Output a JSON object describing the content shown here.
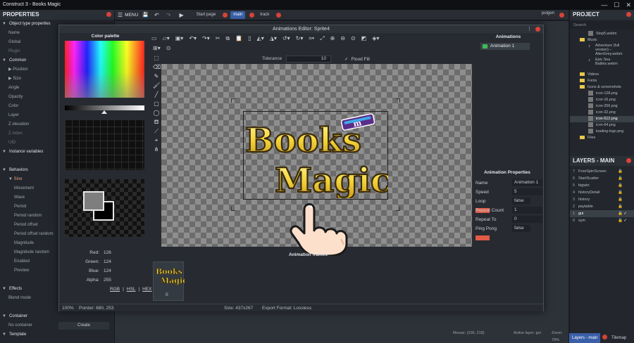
{
  "window": {
    "title": "Construct 3 - Books Magic"
  },
  "menubar": {
    "menu_label": "MENU",
    "tabs": [
      {
        "label": "Start page"
      },
      {
        "label": "main",
        "active": true
      },
      {
        "label": "track"
      }
    ],
    "user": "polgen"
  },
  "properties": {
    "header": "PROPERTIES",
    "sections": [
      {
        "kind": "sec",
        "label": "Object type properties"
      },
      {
        "kind": "line",
        "label": "Name"
      },
      {
        "kind": "line",
        "label": "Global"
      },
      {
        "kind": "line",
        "label": "Plugin",
        "dim": true
      },
      {
        "kind": "sec",
        "label": "Common"
      },
      {
        "kind": "line",
        "label": "Position",
        "arrow": true
      },
      {
        "kind": "line",
        "label": "Size",
        "arrow": true
      },
      {
        "kind": "line",
        "label": "Angle"
      },
      {
        "kind": "line",
        "label": "Opacity"
      },
      {
        "kind": "line",
        "label": "Color"
      },
      {
        "kind": "line",
        "label": "Layer"
      },
      {
        "kind": "line",
        "label": "Z elevation"
      },
      {
        "kind": "line",
        "label": "Z index",
        "dim": true
      },
      {
        "kind": "line",
        "label": "UID",
        "dim": true
      },
      {
        "kind": "sec",
        "label": "Instance variables"
      },
      {
        "kind": "btn",
        "label": "Instance v..."
      },
      {
        "kind": "sec",
        "label": "Behaviors"
      },
      {
        "kind": "sub",
        "label": "Sine"
      },
      {
        "kind": "sub2",
        "label": "Movement"
      },
      {
        "kind": "sub2",
        "label": "Wave"
      },
      {
        "kind": "sub2",
        "label": "Period"
      },
      {
        "kind": "sub2",
        "label": "Period random"
      },
      {
        "kind": "sub2",
        "label": "Period offset"
      },
      {
        "kind": "sub2",
        "label": "Period offset random"
      },
      {
        "kind": "sub2",
        "label": "Magnitude"
      },
      {
        "kind": "sub2",
        "label": "Magnitude random"
      },
      {
        "kind": "sub2",
        "label": "Enabled"
      },
      {
        "kind": "sub2",
        "label": "Preview"
      },
      {
        "kind": "btn",
        "label": "Behav..."
      },
      {
        "kind": "sec",
        "label": "Effects"
      },
      {
        "kind": "line",
        "label": "Blend mode"
      },
      {
        "kind": "btn",
        "label": "Effec..."
      },
      {
        "kind": "sec",
        "label": "Container"
      },
      {
        "kind": "line",
        "label": "No container",
        "button": "Create"
      },
      {
        "kind": "sec",
        "label": "Template"
      }
    ]
  },
  "dialog": {
    "title": "Animations Editor: Sprite4",
    "palette_title": "Color palette",
    "color": {
      "red_label": "Red:",
      "red": "126",
      "green_label": "Green:",
      "green": "124",
      "blue_label": "Blue:",
      "blue": "124",
      "alpha_label": "Alpha:",
      "alpha": "255",
      "formats": [
        "RGB",
        "HSL",
        "HEX"
      ]
    },
    "options": {
      "tolerance_label": "Tolerance",
      "tolerance_value": "10",
      "flood_fill_label": "Flood Fill"
    },
    "logo": {
      "line1": "Books",
      "line2": "Magic",
      "badge": "m"
    },
    "animations_title": "Animations",
    "animations": [
      {
        "label": "Animation 1"
      }
    ],
    "anim_props_title": "Animation Properties",
    "anim_props": [
      {
        "key": "Name",
        "value": "Animation 1"
      },
      {
        "key": "Speed",
        "value": "5"
      },
      {
        "key": "Loop",
        "value": "false",
        "toggle": true
      },
      {
        "key": "Repeat Count",
        "value": "1"
      },
      {
        "key": "Repeat To",
        "value": "0"
      },
      {
        "key": "Ping Pong",
        "value": "false",
        "toggle": true
      }
    ],
    "frames_label": "Animation frames",
    "frames": [
      {
        "index": "0",
        "thumb_line1": "Books",
        "thumb_line2": "Magic"
      }
    ],
    "status": {
      "zoom": "100%",
      "pointer": "Pointer: 680, 253",
      "size": "Size: 437x267",
      "export": "Export Format: Lossless"
    }
  },
  "project": {
    "header": "PROJECT",
    "search_placeholder": "Search",
    "items": [
      {
        "type": "file",
        "label": "Stop5.webm",
        "indent": 2
      },
      {
        "type": "folder",
        "label": "Music",
        "indent": 1
      },
      {
        "type": "audio",
        "label": "Adventure (full version) – AlienGrey.webm",
        "indent": 2
      },
      {
        "type": "audio",
        "label": "Epic Sea Battles.webm",
        "indent": 2
      },
      {
        "type": "folder",
        "label": "Videos",
        "indent": 1
      },
      {
        "type": "folder",
        "label": "Fonts",
        "indent": 1
      },
      {
        "type": "folder",
        "label": "Icons & screenshots",
        "indent": 1
      },
      {
        "type": "img",
        "label": "icon-128.png",
        "indent": 2
      },
      {
        "type": "img",
        "label": "icon-16.png",
        "indent": 2
      },
      {
        "type": "img",
        "label": "icon-256.png",
        "indent": 2
      },
      {
        "type": "img",
        "label": "icon-32.png",
        "indent": 2
      },
      {
        "type": "img",
        "label": "icon-512.png",
        "indent": 2,
        "selected": true
      },
      {
        "type": "img",
        "label": "icon-64.png",
        "indent": 2
      },
      {
        "type": "img",
        "label": "loading-logo.png",
        "indent": 2
      },
      {
        "type": "folder",
        "label": "Files",
        "indent": 1
      }
    ]
  },
  "layers": {
    "header": "LAYERS - MAIN",
    "items": [
      {
        "num": "7",
        "name": "FreeSpinScreen"
      },
      {
        "num": "6",
        "name": "StartScatter"
      },
      {
        "num": "5",
        "name": "bigwin"
      },
      {
        "num": "4",
        "name": "historyDetail"
      },
      {
        "num": "3",
        "name": "history"
      },
      {
        "num": "2",
        "name": "paytable"
      },
      {
        "num": "1",
        "name": "gui",
        "selected": true,
        "checked": true
      },
      {
        "num": "0",
        "name": "sym",
        "checked": true
      }
    ],
    "tabs": [
      {
        "label": "Layers - main",
        "active": true
      },
      {
        "label": "Tilemap"
      }
    ]
  },
  "mainstatus": {
    "mouse": "Mouse: (100, 218)",
    "active_layer": "Active layer: gui",
    "zoom": "Zoom: 79%"
  },
  "colors": {
    "accent": "#3a5fa8",
    "close_red": "#d8433a",
    "toggle_red": "#e05a45",
    "folder": "#e8c84b"
  }
}
